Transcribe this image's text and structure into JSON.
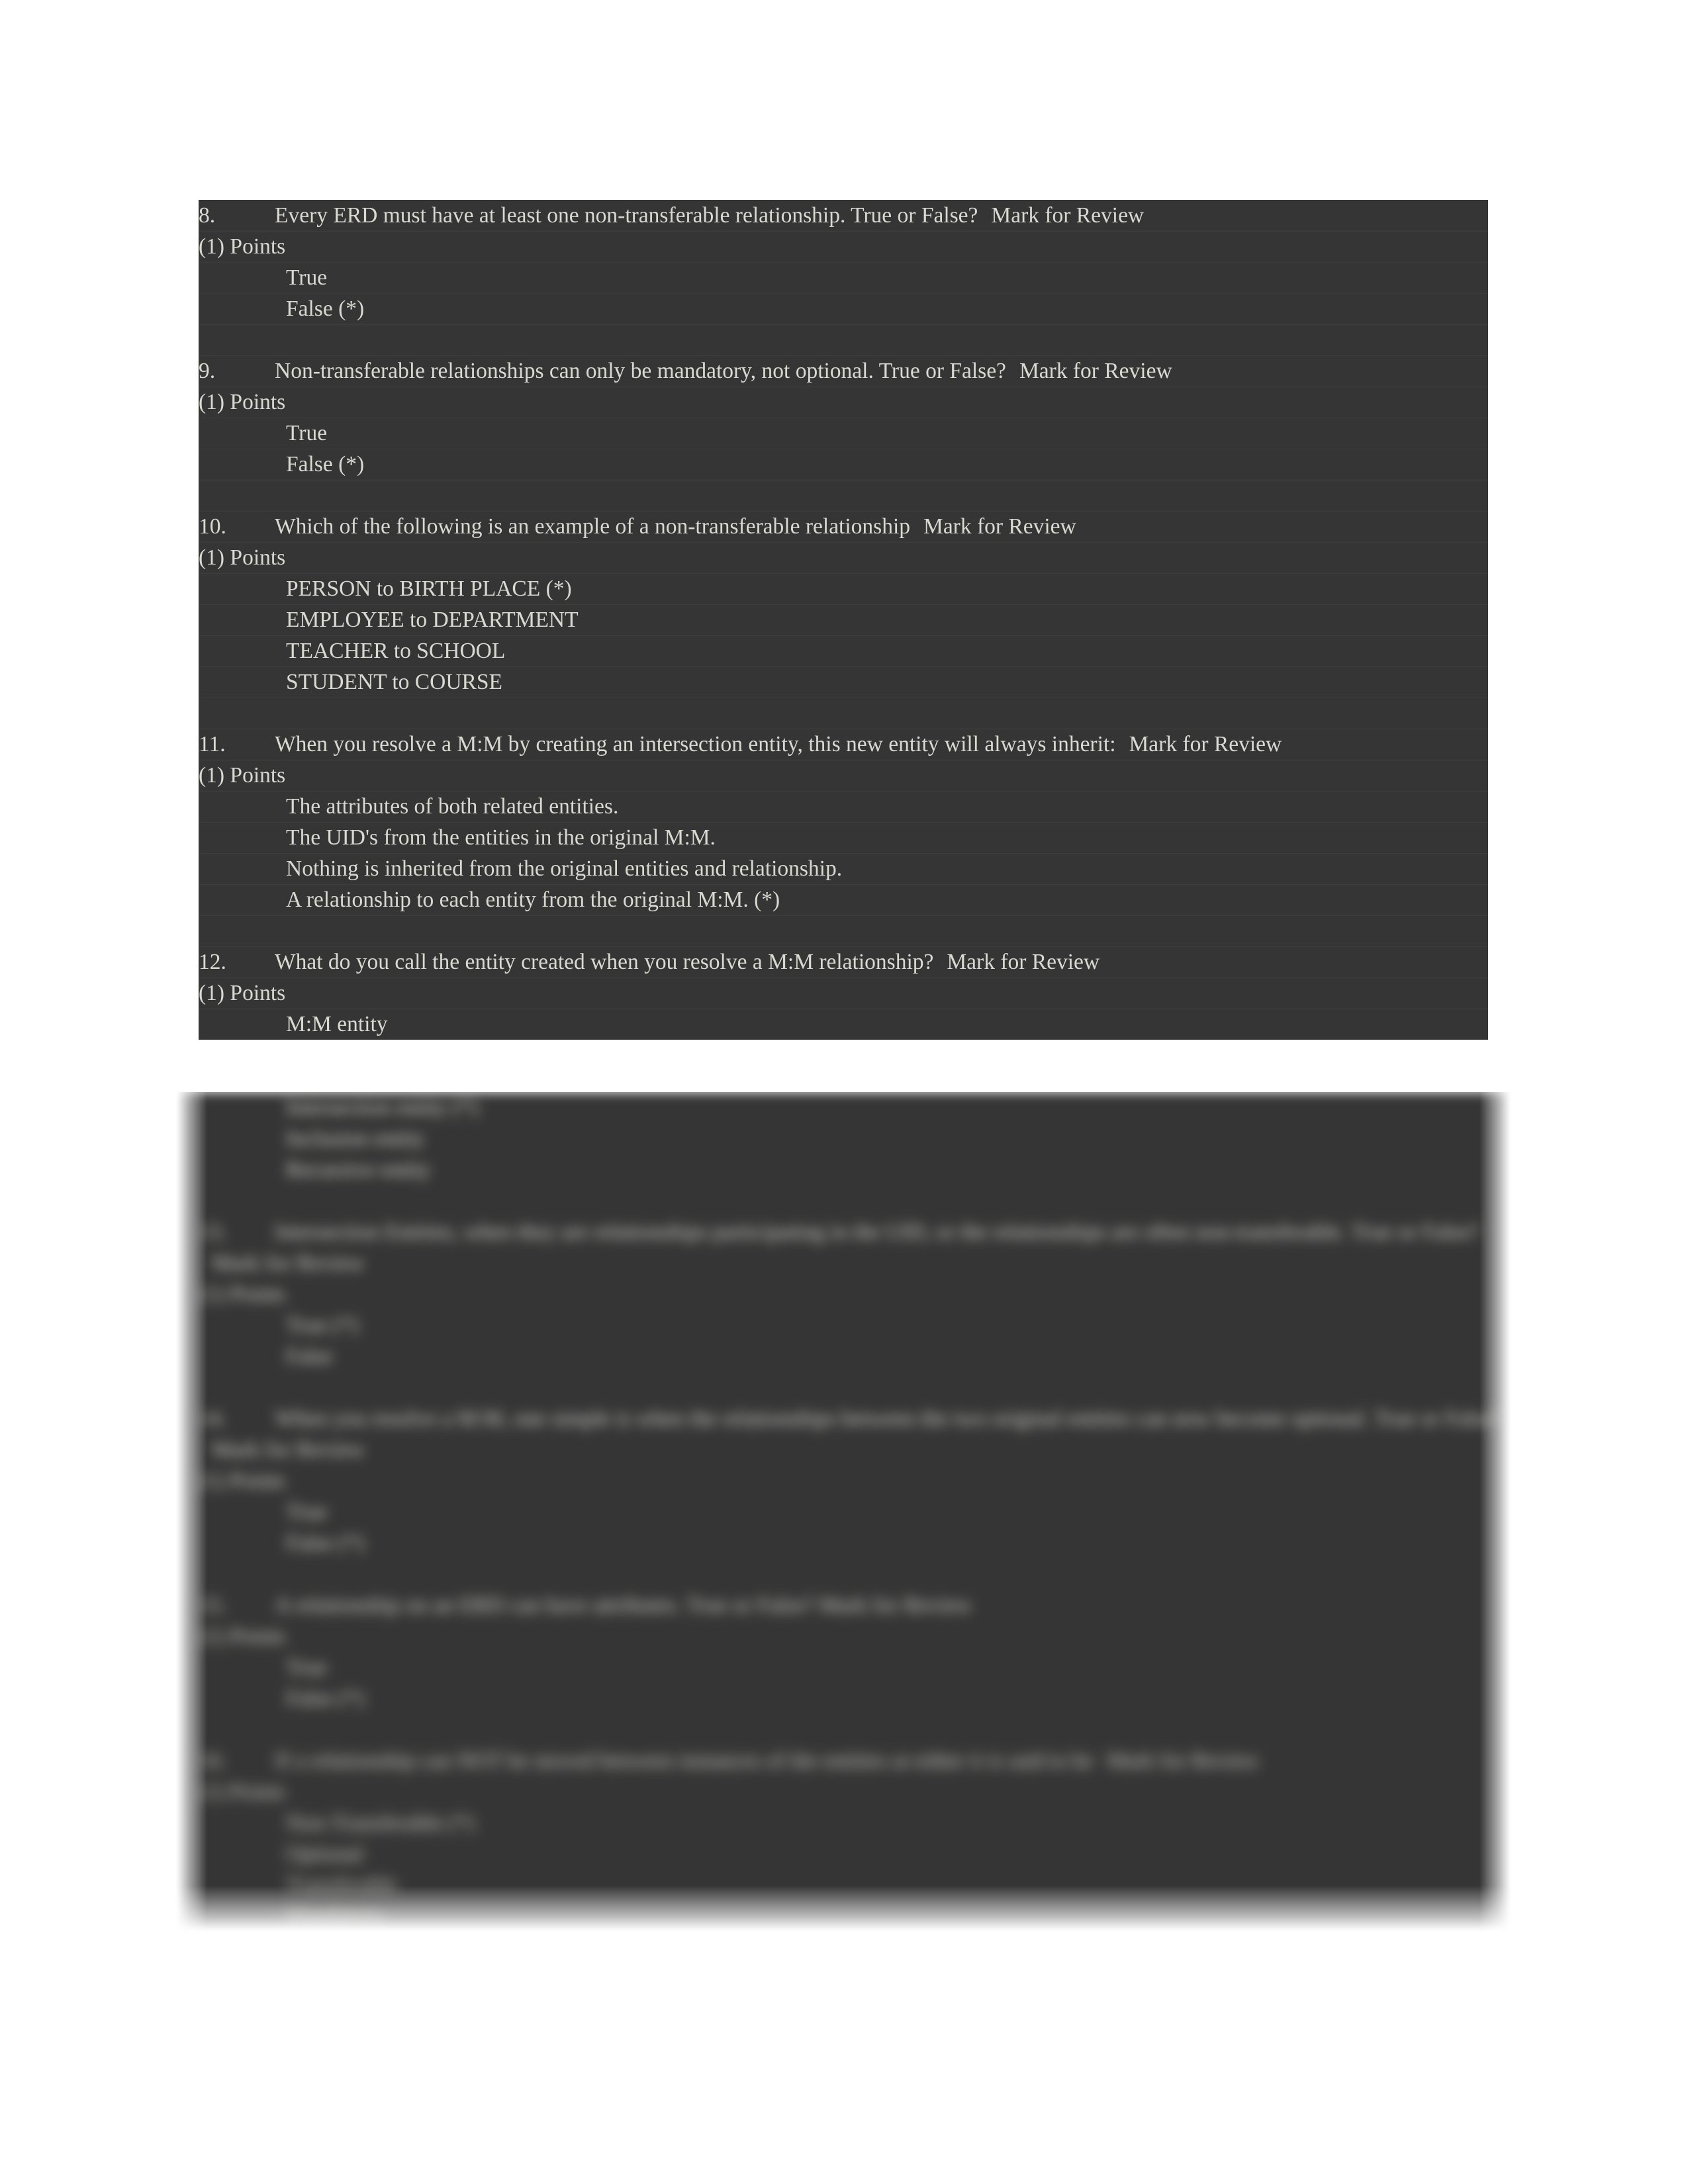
{
  "document": {
    "type": "quiz-answer-key",
    "points_label": "(1) Points",
    "mark_for_review": "Mark for Review",
    "colors": {
      "panel_background": "#353535",
      "text": "#d9d9d2",
      "page_background": "#ffffff"
    }
  },
  "questions": [
    {
      "number": "8.",
      "text": "Every ERD must have at least one non-transferable relationship. True or False?",
      "mark": "Mark for Review",
      "points": "(1) Points",
      "options": [
        "True",
        "False (*)"
      ],
      "blurred": false
    },
    {
      "number": "9.",
      "text": "Non-transferable relationships can only be mandatory, not optional. True or False?",
      "mark": "Mark for Review",
      "points": "(1) Points",
      "options": [
        "True",
        "False (*)"
      ],
      "blurred": false
    },
    {
      "number": "10.",
      "text": "Which of the following is an example of a non-transferable relationship",
      "mark": "Mark for Review",
      "points": "(1) Points",
      "options": [
        "PERSON to BIRTH PLACE (*)",
        "EMPLOYEE to DEPARTMENT",
        "TEACHER to SCHOOL",
        "STUDENT to COURSE"
      ],
      "blurred": false
    },
    {
      "number": "11.",
      "text": "When you resolve a M:M by creating an intersection entity, this new entity will always inherit:",
      "mark": "Mark for Review",
      "points": "(1) Points",
      "options": [
        "The attributes of both related entities.",
        "The UID's from the entities in the original M:M.",
        "Nothing is inherited from the original entities and relationship.",
        "A relationship to each entity from the original M:M. (*)"
      ],
      "blurred": false
    },
    {
      "number": "12.",
      "text": "What do you call the entity created when you resolve a M:M relationship?",
      "mark": "Mark for Review",
      "points": "(1) Points",
      "options": [
        "M:M entity",
        "Intersection entity (*)",
        "Inclusion entity",
        "Recursive entity"
      ],
      "blurred": true
    },
    {
      "number": "13.",
      "text": "Intersection Entities, when they are relationships participating in the UID, or the relationships are often non-transferable. True or False?",
      "mark": "Mark for Review",
      "points": "(1) Points",
      "options": [
        "True (*)",
        "False"
      ],
      "blurred": true
    },
    {
      "number": "14.",
      "text": "When you resolve a M:M, one simple is when the relationships between the two original entities can now become optional. True or False?",
      "mark": "Mark for Review",
      "points": "(1) Points",
      "options": [
        "True",
        "False (*)"
      ],
      "blurred": true
    },
    {
      "number": "15.",
      "text": "A relationship on an ERD can have attributes. True or False? Mark for Review",
      "mark": "Mark for Review",
      "points": "(1) Points",
      "options": [
        "True",
        "False (*)"
      ],
      "blurred": true
    },
    {
      "number": "16.",
      "text": "If a relationship can NOT be moved between instances of the entities at either it is said to be",
      "mark": "Mark for Review",
      "points": "(1) Points",
      "options": [
        "Non-Transferable (*)",
        "Optional",
        "Transferable",
        "Mandatory"
      ],
      "blurred": true
    }
  ]
}
